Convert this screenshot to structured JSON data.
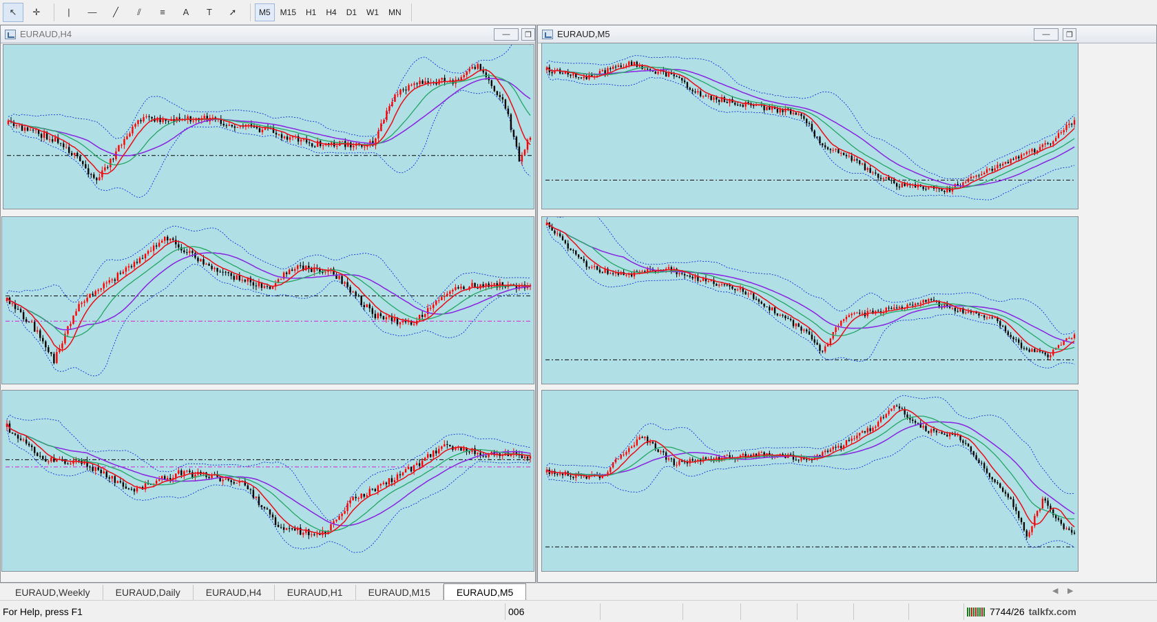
{
  "toolbar": {
    "tools": [
      {
        "name": "cursor-icon",
        "glyph": "↖"
      },
      {
        "name": "crosshair-icon",
        "glyph": "✛"
      },
      {
        "name": "vertical-line-icon",
        "glyph": "|"
      },
      {
        "name": "horizontal-line-icon",
        "glyph": "—"
      },
      {
        "name": "trendline-icon",
        "glyph": "╱"
      },
      {
        "name": "equidistant-channel-icon",
        "glyph": "⫽"
      },
      {
        "name": "fibonacci-icon",
        "glyph": "≡"
      },
      {
        "name": "text-icon",
        "glyph": "A"
      },
      {
        "name": "text-label-icon",
        "glyph": "T"
      },
      {
        "name": "arrows-icon",
        "glyph": "➚"
      }
    ],
    "timeframes": [
      "M5",
      "M15",
      "H1",
      "H4",
      "D1",
      "W1",
      "MN"
    ],
    "active_timeframe": "M5"
  },
  "windows": {
    "left_title": "EURAUD,H4",
    "right_title": "EURAUD,M5"
  },
  "tabs": [
    "EURAUD,Weekly",
    "EURAUD,Daily",
    "EURAUD,H4",
    "EURAUD,H1",
    "EURAUD,M15",
    "EURAUD,M5"
  ],
  "active_tab": "EURAUD,M5",
  "status": {
    "help": "For Help, press F1",
    "profile": "006",
    "traffic": "7744/26",
    "watermark": "talkfx.com"
  },
  "colors": {
    "chart_bg": "#b0e0e6",
    "bull_candle": "#ff0000",
    "bear_candle": "#000000",
    "ma_fast": "#e8141c",
    "ma_mid": "#2ca86a",
    "ma_slow": "#8a2be2",
    "bands": "#1f3fe0"
  }
}
